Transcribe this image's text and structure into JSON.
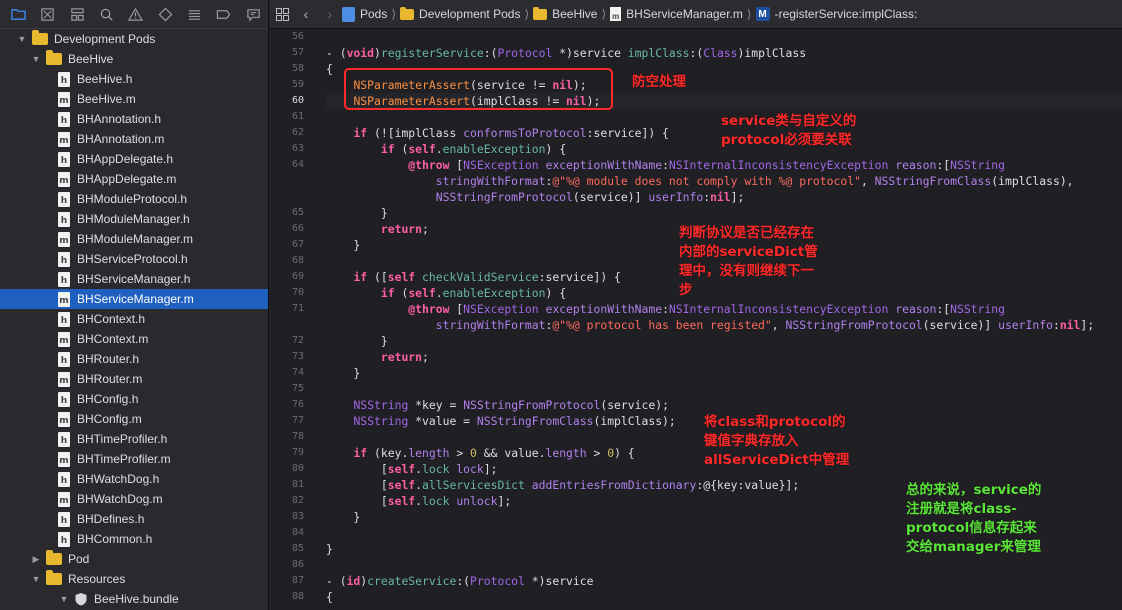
{
  "navigator": {
    "toolbar_icons": [
      "folder-icon",
      "source-control-icon",
      "hierarchy-icon",
      "search-icon",
      "warning-icon",
      "test-icon",
      "debug-icon",
      "breakpoint-icon",
      "report-icon"
    ],
    "tree": [
      {
        "label": "Development Pods",
        "kind": "folder",
        "depth": 1,
        "expanded": true
      },
      {
        "label": "BeeHive",
        "kind": "folder",
        "depth": 2,
        "expanded": true
      },
      {
        "label": "BeeHive.h",
        "kind": "h",
        "depth": 3
      },
      {
        "label": "BeeHive.m",
        "kind": "m",
        "depth": 3
      },
      {
        "label": "BHAnnotation.h",
        "kind": "h",
        "depth": 3
      },
      {
        "label": "BHAnnotation.m",
        "kind": "m",
        "depth": 3
      },
      {
        "label": "BHAppDelegate.h",
        "kind": "h",
        "depth": 3
      },
      {
        "label": "BHAppDelegate.m",
        "kind": "m",
        "depth": 3
      },
      {
        "label": "BHModuleProtocol.h",
        "kind": "h",
        "depth": 3
      },
      {
        "label": "BHModuleManager.h",
        "kind": "h",
        "depth": 3
      },
      {
        "label": "BHModuleManager.m",
        "kind": "m",
        "depth": 3
      },
      {
        "label": "BHServiceProtocol.h",
        "kind": "h",
        "depth": 3
      },
      {
        "label": "BHServiceManager.h",
        "kind": "h",
        "depth": 3
      },
      {
        "label": "BHServiceManager.m",
        "kind": "m",
        "depth": 3,
        "selected": true
      },
      {
        "label": "BHContext.h",
        "kind": "h",
        "depth": 3
      },
      {
        "label": "BHContext.m",
        "kind": "m",
        "depth": 3
      },
      {
        "label": "BHRouter.h",
        "kind": "h",
        "depth": 3
      },
      {
        "label": "BHRouter.m",
        "kind": "m",
        "depth": 3
      },
      {
        "label": "BHConfig.h",
        "kind": "h",
        "depth": 3
      },
      {
        "label": "BHConfig.m",
        "kind": "m",
        "depth": 3
      },
      {
        "label": "BHTimeProfiler.h",
        "kind": "h",
        "depth": 3
      },
      {
        "label": "BHTimeProfiler.m",
        "kind": "m",
        "depth": 3
      },
      {
        "label": "BHWatchDog.h",
        "kind": "h",
        "depth": 3
      },
      {
        "label": "BHWatchDog.m",
        "kind": "m",
        "depth": 3
      },
      {
        "label": "BHDefines.h",
        "kind": "h",
        "depth": 3
      },
      {
        "label": "BHCommon.h",
        "kind": "h",
        "depth": 3
      },
      {
        "label": "Pod",
        "kind": "folder",
        "depth": 2,
        "expanded": false
      },
      {
        "label": "Resources",
        "kind": "folder",
        "depth": 2,
        "expanded": true
      },
      {
        "label": "BeeHive.bundle",
        "kind": "bundle",
        "depth": 3,
        "expanded": true
      }
    ]
  },
  "jumpbar": {
    "items": [
      "Pods",
      "Development Pods",
      "BeeHive",
      "BHServiceManager.m",
      "-registerService:implClass:"
    ],
    "method_badge": "M"
  },
  "editor": {
    "lines": [
      {
        "n": "56",
        "tokens": [
          [
            "",
            ""
          ]
        ]
      },
      {
        "n": "57",
        "tokens": [
          [
            "",
            "- ("
          ],
          [
            "kw",
            "void"
          ],
          [
            "",
            ")"
          ],
          [
            "fn",
            "registerService"
          ],
          [
            "",
            ":("
          ],
          [
            "pj",
            "Protocol"
          ],
          [
            "",
            " *)service "
          ],
          [
            "fn",
            "implClass"
          ],
          [
            "",
            ":("
          ],
          [
            "pj",
            "Class"
          ],
          [
            "",
            ")implClass"
          ]
        ]
      },
      {
        "n": "58",
        "tokens": [
          [
            "",
            "{"
          ]
        ]
      },
      {
        "n": "59",
        "tokens": [
          [
            "",
            "    "
          ],
          [
            "mc",
            "NSParameterAssert"
          ],
          [
            "",
            "(service != "
          ],
          [
            "kw",
            "nil"
          ],
          [
            "",
            ");"
          ]
        ]
      },
      {
        "n": "60",
        "tokens": [
          [
            "",
            "    "
          ],
          [
            "mc",
            "NSParameterAssert"
          ],
          [
            "",
            "(implClass != "
          ],
          [
            "kw",
            "nil"
          ],
          [
            "",
            ");"
          ]
        ],
        "current": true
      },
      {
        "n": "61",
        "tokens": [
          [
            "",
            ""
          ]
        ]
      },
      {
        "n": "62",
        "tokens": [
          [
            "",
            "    "
          ],
          [
            "kw",
            "if"
          ],
          [
            "",
            " (![implClass "
          ],
          [
            "pjf",
            "conformsToProtocol"
          ],
          [
            "",
            ":service]) {"
          ]
        ]
      },
      {
        "n": "63",
        "tokens": [
          [
            "",
            "        "
          ],
          [
            "kw",
            "if"
          ],
          [
            "",
            " ("
          ],
          [
            "kw",
            "self"
          ],
          [
            "",
            "."
          ],
          [
            "fn",
            "enableException"
          ],
          [
            "",
            ") {"
          ]
        ]
      },
      {
        "n": "64",
        "tokens": [
          [
            "",
            "            "
          ],
          [
            "kw",
            "@throw"
          ],
          [
            "",
            " ["
          ],
          [
            "pj",
            "NSException"
          ],
          [
            "",
            " "
          ],
          [
            "pjf",
            "exceptionWithName"
          ],
          [
            "",
            ":"
          ],
          [
            "pj",
            "NSInternalInconsistencyException"
          ],
          [
            "",
            " "
          ],
          [
            "pjf",
            "reason"
          ],
          [
            "",
            ":["
          ],
          [
            "pj",
            "NSString"
          ]
        ]
      },
      {
        "n": "",
        "tokens": [
          [
            "",
            "                "
          ],
          [
            "pjf",
            "stringWithFormat"
          ],
          [
            "",
            ":"
          ],
          [
            "str",
            "@\"%@ module does not comply with %@ protocol\""
          ],
          [
            "",
            ", "
          ],
          [
            "pjf",
            "NSStringFromClass"
          ],
          [
            "",
            "(implClass),"
          ]
        ]
      },
      {
        "n": "",
        "tokens": [
          [
            "",
            "                "
          ],
          [
            "pjf",
            "NSStringFromProtocol"
          ],
          [
            "",
            "(service)] "
          ],
          [
            "pjf",
            "userInfo"
          ],
          [
            "",
            ":"
          ],
          [
            "kw",
            "nil"
          ],
          [
            "",
            "];"
          ]
        ]
      },
      {
        "n": "65",
        "tokens": [
          [
            "",
            "        }"
          ]
        ]
      },
      {
        "n": "66",
        "tokens": [
          [
            "",
            "        "
          ],
          [
            "kw",
            "return"
          ],
          [
            "",
            ";"
          ]
        ]
      },
      {
        "n": "67",
        "tokens": [
          [
            "",
            "    }"
          ]
        ]
      },
      {
        "n": "68",
        "tokens": [
          [
            "",
            ""
          ]
        ]
      },
      {
        "n": "69",
        "tokens": [
          [
            "",
            "    "
          ],
          [
            "kw",
            "if"
          ],
          [
            "",
            " (["
          ],
          [
            "kw",
            "self"
          ],
          [
            "",
            " "
          ],
          [
            "fn",
            "checkValidService"
          ],
          [
            "",
            ":service]) {"
          ]
        ]
      },
      {
        "n": "70",
        "tokens": [
          [
            "",
            "        "
          ],
          [
            "kw",
            "if"
          ],
          [
            "",
            " ("
          ],
          [
            "kw",
            "self"
          ],
          [
            "",
            "."
          ],
          [
            "fn",
            "enableException"
          ],
          [
            "",
            ") {"
          ]
        ]
      },
      {
        "n": "71",
        "tokens": [
          [
            "",
            "            "
          ],
          [
            "kw",
            "@throw"
          ],
          [
            "",
            " ["
          ],
          [
            "pj",
            "NSException"
          ],
          [
            "",
            " "
          ],
          [
            "pjf",
            "exceptionWithName"
          ],
          [
            "",
            ":"
          ],
          [
            "pj",
            "NSInternalInconsistencyException"
          ],
          [
            "",
            " "
          ],
          [
            "pjf",
            "reason"
          ],
          [
            "",
            ":["
          ],
          [
            "pj",
            "NSString"
          ]
        ]
      },
      {
        "n": "",
        "tokens": [
          [
            "",
            "                "
          ],
          [
            "pjf",
            "stringWithFormat"
          ],
          [
            "",
            ":"
          ],
          [
            "str",
            "@\"%@ protocol has been registed\""
          ],
          [
            "",
            ", "
          ],
          [
            "pjf",
            "NSStringFromProtocol"
          ],
          [
            "",
            "(service)] "
          ],
          [
            "pjf",
            "userInfo"
          ],
          [
            "",
            ":"
          ],
          [
            "kw",
            "nil"
          ],
          [
            "",
            "];"
          ]
        ]
      },
      {
        "n": "72",
        "tokens": [
          [
            "",
            "        }"
          ]
        ]
      },
      {
        "n": "73",
        "tokens": [
          [
            "",
            "        "
          ],
          [
            "kw",
            "return"
          ],
          [
            "",
            ";"
          ]
        ]
      },
      {
        "n": "74",
        "tokens": [
          [
            "",
            "    }"
          ]
        ]
      },
      {
        "n": "75",
        "tokens": [
          [
            "",
            ""
          ]
        ]
      },
      {
        "n": "76",
        "tokens": [
          [
            "",
            "    "
          ],
          [
            "pj",
            "NSString"
          ],
          [
            "",
            " *key = "
          ],
          [
            "pjf",
            "NSStringFromProtocol"
          ],
          [
            "",
            "(service);"
          ]
        ]
      },
      {
        "n": "77",
        "tokens": [
          [
            "",
            "    "
          ],
          [
            "pj",
            "NSString"
          ],
          [
            "",
            " *value = "
          ],
          [
            "pjf",
            "NSStringFromClass"
          ],
          [
            "",
            "(implClass);"
          ]
        ]
      },
      {
        "n": "78",
        "tokens": [
          [
            "",
            ""
          ]
        ]
      },
      {
        "n": "79",
        "tokens": [
          [
            "",
            "    "
          ],
          [
            "kw",
            "if"
          ],
          [
            "",
            " (key."
          ],
          [
            "pjf",
            "length"
          ],
          [
            "",
            " > "
          ],
          [
            "num",
            "0"
          ],
          [
            "",
            " && value."
          ],
          [
            "pjf",
            "length"
          ],
          [
            "",
            " > "
          ],
          [
            "num",
            "0"
          ],
          [
            "",
            ") {"
          ]
        ]
      },
      {
        "n": "80",
        "tokens": [
          [
            "",
            "        ["
          ],
          [
            "kw",
            "self"
          ],
          [
            "",
            "."
          ],
          [
            "fn",
            "lock"
          ],
          [
            "",
            " "
          ],
          [
            "pjf",
            "lock"
          ],
          [
            "",
            "];"
          ]
        ]
      },
      {
        "n": "81",
        "tokens": [
          [
            "",
            "        ["
          ],
          [
            "kw",
            "self"
          ],
          [
            "",
            "."
          ],
          [
            "fn",
            "allServicesDict"
          ],
          [
            "",
            " "
          ],
          [
            "pjf",
            "addEntriesFromDictionary"
          ],
          [
            "",
            ":@{key:value}];"
          ]
        ]
      },
      {
        "n": "82",
        "tokens": [
          [
            "",
            "        ["
          ],
          [
            "kw",
            "self"
          ],
          [
            "",
            "."
          ],
          [
            "fn",
            "lock"
          ],
          [
            "",
            " "
          ],
          [
            "pjf",
            "unlock"
          ],
          [
            "",
            "];"
          ]
        ]
      },
      {
        "n": "83",
        "tokens": [
          [
            "",
            "    }"
          ]
        ]
      },
      {
        "n": "84",
        "tokens": [
          [
            "",
            ""
          ]
        ]
      },
      {
        "n": "85",
        "tokens": [
          [
            "",
            "}"
          ]
        ]
      },
      {
        "n": "86",
        "tokens": [
          [
            "",
            ""
          ]
        ]
      },
      {
        "n": "87",
        "tokens": [
          [
            "",
            "- ("
          ],
          [
            "kw",
            "id"
          ],
          [
            "",
            ")"
          ],
          [
            "fn",
            "createService"
          ],
          [
            "",
            ":("
          ],
          [
            "pj",
            "Protocol"
          ],
          [
            "",
            " *)service"
          ]
        ]
      },
      {
        "n": "88",
        "tokens": [
          [
            "",
            "{"
          ]
        ]
      }
    ]
  },
  "annotations": {
    "nil_check": "防空处理",
    "conform": "service类与自定义的\nprotocol必须要关联",
    "registered": "判断协议是否已经存在\n内部的serviceDict管\n理中，没有则继续下一\n步",
    "store": "将class和protocol的\n键值字典存放入\nallServiceDict中管理",
    "summary": "总的来说，service的\n注册就是将class-\nprotocol信息存起来\n交给manager来管理"
  },
  "colors": {
    "selection": "#1f5fbf",
    "annotation_red": "#ff2a2a",
    "annotation_green": "#57e83a",
    "editor_bg": "#1f1f24"
  }
}
